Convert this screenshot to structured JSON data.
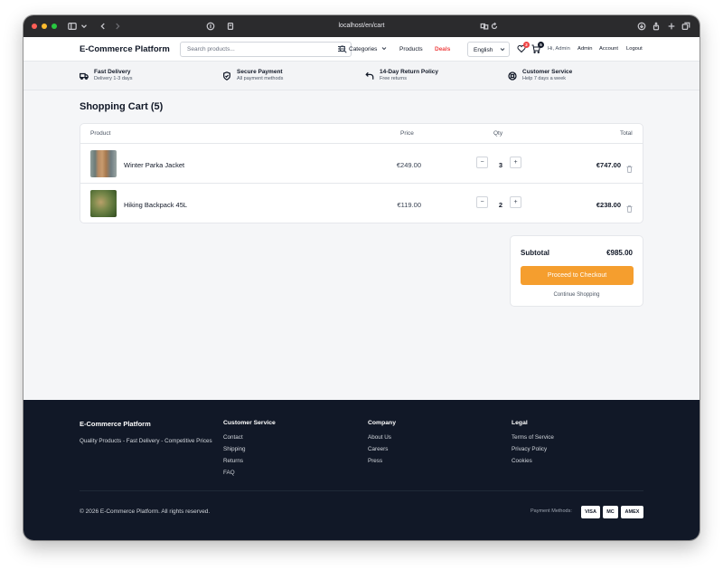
{
  "browser": {
    "url": "localhost/en/cart"
  },
  "header": {
    "brand": "E-Commerce Platform",
    "search_placeholder": "Search products...",
    "categories": "Categories",
    "products": "Products",
    "deals": "Deals",
    "language": "English",
    "wishlist_count": "2",
    "cart_count": "5",
    "greeting": "Hi, Admin",
    "admin": "Admin",
    "account": "Account",
    "logout": "Logout"
  },
  "features": [
    {
      "title": "Fast Delivery",
      "subtitle": "Delivery 1-3 days",
      "icon": "truck-icon"
    },
    {
      "title": "Secure Payment",
      "subtitle": "All payment methods",
      "icon": "shield-icon"
    },
    {
      "title": "14-Day Return Policy",
      "subtitle": "Free returns",
      "icon": "return-arrow-icon"
    },
    {
      "title": "Customer Service",
      "subtitle": "Help 7 days a week",
      "icon": "lifebuoy-icon"
    }
  ],
  "cart": {
    "title": "Shopping Cart (5)",
    "columns": {
      "product": "Product",
      "price": "Price",
      "qty": "Qty",
      "total": "Total"
    },
    "items": [
      {
        "name": "Winter Parka Jacket",
        "price": "€249.00",
        "qty": "3",
        "total": "€747.00"
      },
      {
        "name": "Hiking Backpack 45L",
        "price": "€119.00",
        "qty": "2",
        "total": "€238.00"
      }
    ],
    "qty_minus": "−",
    "qty_plus": "+",
    "subtotal_label": "Subtotal",
    "subtotal_value": "€985.00",
    "checkout": "Proceed to Checkout",
    "continue": "Continue Shopping"
  },
  "footer": {
    "brand": "E-Commerce Platform",
    "tagline": "Quality Products - Fast Delivery - Competitive Prices",
    "columns": [
      {
        "heading": "Customer Service",
        "links": [
          "Contact",
          "Shipping",
          "Returns",
          "FAQ"
        ]
      },
      {
        "heading": "Company",
        "links": [
          "About Us",
          "Careers",
          "Press"
        ]
      },
      {
        "heading": "Legal",
        "links": [
          "Terms of Service",
          "Privacy Policy",
          "Cookies"
        ]
      }
    ],
    "copyright": "© 2026 E-Commerce Platform. All rights reserved.",
    "payment_label": "Payment Methods:",
    "payment_methods": [
      "VISA",
      "MC",
      "AMEX"
    ]
  },
  "colors": {
    "accent": "#f59e2e",
    "deals": "#ef4444",
    "footer_bg": "#111827"
  }
}
